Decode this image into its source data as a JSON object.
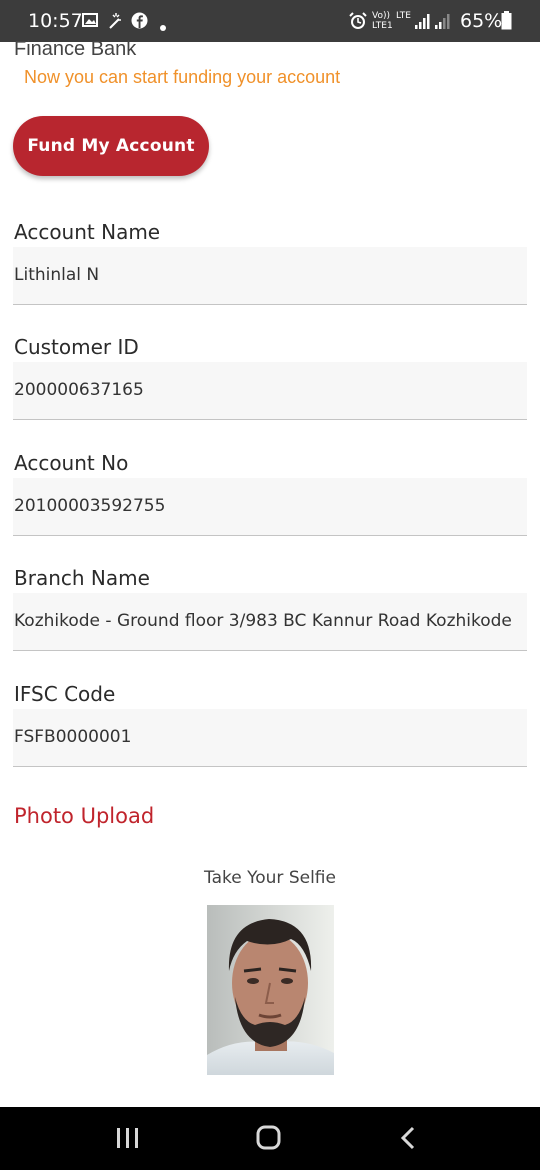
{
  "status_bar": {
    "time": "10:57",
    "battery": "65%",
    "volte_label": "Vo))",
    "lte_label": "LTE",
    "lte1_label": "LTE1",
    "icons": [
      "gallery-icon",
      "magic-wand-icon",
      "facebook-icon",
      "notification-dot-icon",
      "alarm-icon",
      "signal-icon",
      "signal-icon-2",
      "battery-icon"
    ]
  },
  "header": {
    "bank_name": "Finance Bank",
    "banner": "Now you can start funding your account"
  },
  "fund_button": {
    "label": "Fund My Account"
  },
  "fields": [
    {
      "label": "Account Name",
      "value": "Lithinlal N"
    },
    {
      "label": "Customer ID",
      "value": "200000637165"
    },
    {
      "label": "Account No",
      "value": "20100003592755"
    },
    {
      "label": "Branch Name",
      "value": "Kozhikode - Ground floor 3/983 BC Kannur Road Kozhikode"
    },
    {
      "label": "IFSC Code",
      "value": "FSFB0000001"
    }
  ],
  "photo_section": {
    "title": "Photo Upload",
    "selfie_label": "Take Your Selfie"
  },
  "nav_bar": {
    "icons": [
      "recent-apps-icon",
      "home-icon",
      "back-icon"
    ]
  },
  "colors": {
    "accent_red": "#b8262f",
    "banner_orange": "#f0912a",
    "section_red": "#c0242c",
    "status_bar": "#3c3c3c"
  }
}
